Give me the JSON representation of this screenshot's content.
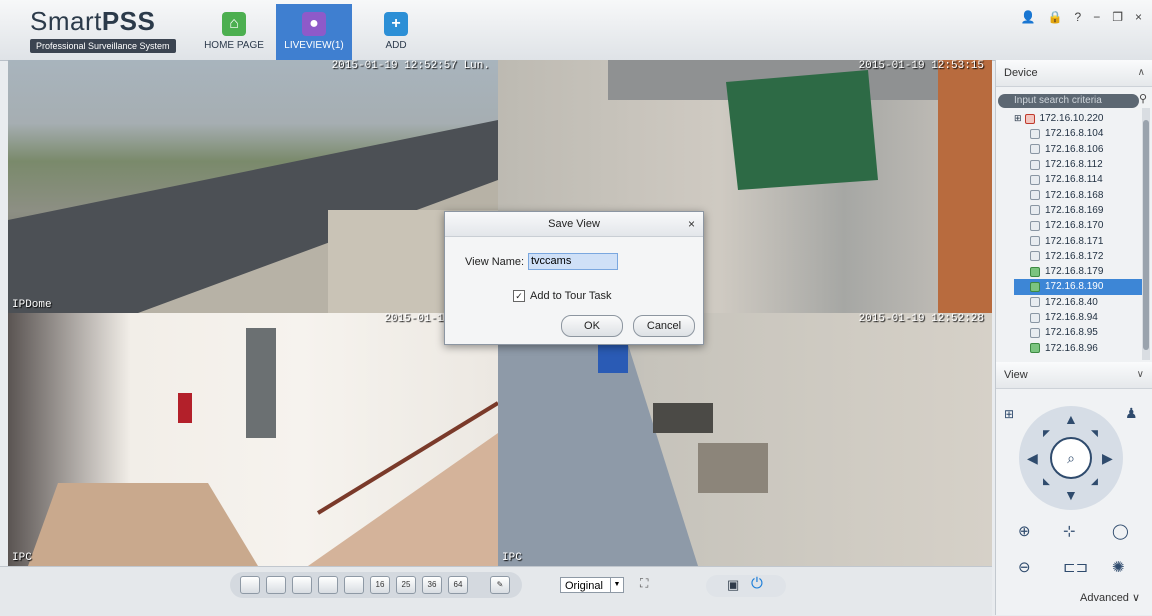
{
  "app": {
    "name_plain": "Smart",
    "name_bold": "PSS",
    "subtitle": "Professional Surveillance System"
  },
  "nav": {
    "home": "HOME PAGE",
    "liveview": "LIVEVIEW(1)",
    "add": "ADD"
  },
  "window_controls": [
    "👤",
    "🔒",
    "?",
    "−",
    "❐",
    "×"
  ],
  "cameras": [
    {
      "timestamp": "2015-01-19 12:52:57 Lun.",
      "name": "IPDome"
    },
    {
      "timestamp": "2015-01-19 12:53:15",
      "name": ""
    },
    {
      "timestamp": "2015-01-19 12:52",
      "name": "IPC"
    },
    {
      "timestamp": "2015-01-19 12:52:28",
      "name": "IPC"
    }
  ],
  "dialog": {
    "title": "Save View",
    "close": "×",
    "view_name_label": "View Name:",
    "view_name_value": "tvccams",
    "checkbox_label": "Add to Tour Task",
    "checkbox_checked": "✓",
    "ok": "OK",
    "cancel": "Cancel"
  },
  "device_panel": {
    "title": "Device",
    "search_placeholder": "Input search criteria",
    "items": [
      {
        "label": "172.16.10.220",
        "selected": false
      },
      {
        "label": "172.16.8.104",
        "selected": false
      },
      {
        "label": "172.16.8.106",
        "selected": false
      },
      {
        "label": "172.16.8.112",
        "selected": false
      },
      {
        "label": "172.16.8.114",
        "selected": false
      },
      {
        "label": "172.16.8.168",
        "selected": false
      },
      {
        "label": "172.16.8.169",
        "selected": false
      },
      {
        "label": "172.16.8.170",
        "selected": false
      },
      {
        "label": "172.16.8.171",
        "selected": false
      },
      {
        "label": "172.16.8.172",
        "selected": false
      },
      {
        "label": "172.16.8.179",
        "selected": false
      },
      {
        "label": "172.16.8.190",
        "selected": true
      },
      {
        "label": "172.16.8.40",
        "selected": false
      },
      {
        "label": "172.16.8.94",
        "selected": false
      },
      {
        "label": "172.16.8.95",
        "selected": false
      },
      {
        "label": "172.16.8.96",
        "selected": false
      }
    ]
  },
  "view_panel": {
    "title": "View",
    "advanced": "Advanced"
  },
  "bottom": {
    "layouts": [
      "",
      "",
      "",
      "",
      "",
      "16",
      "25",
      "36",
      "64"
    ],
    "stream": "Original"
  }
}
